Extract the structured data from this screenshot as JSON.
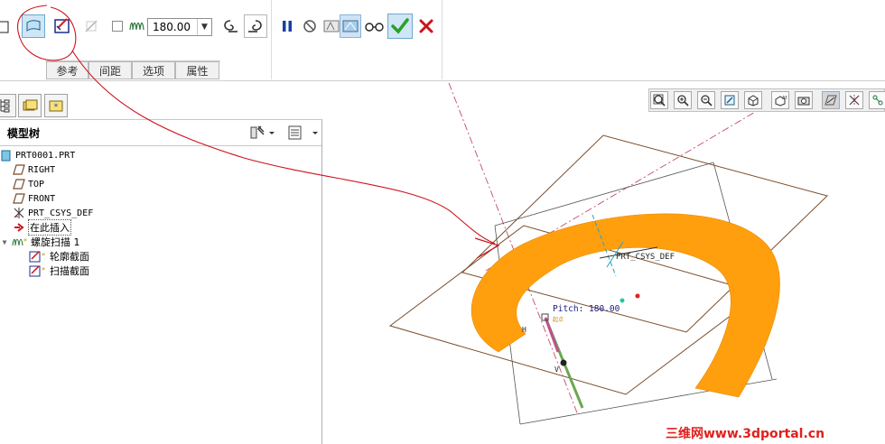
{
  "dashboard": {
    "pitch_value": "180.00",
    "tabs": [
      "参考",
      "间距",
      "选项",
      "属性"
    ]
  },
  "navigator": {
    "title": "模型树",
    "tree": [
      {
        "label": "PRT0001.PRT"
      },
      {
        "label": "RIGHT"
      },
      {
        "label": "TOP"
      },
      {
        "label": "FRONT"
      },
      {
        "label": "PRT_CSYS_DEF"
      },
      {
        "label": "在此插入"
      },
      {
        "label": "螺旋扫描 1"
      },
      {
        "label": "轮廓截面"
      },
      {
        "label": "扫描截面"
      }
    ]
  },
  "graphics": {
    "csys_label": "PRT_CSYS_DEF",
    "pitch_label": "Pitch: 180.00",
    "axis_h": "H",
    "axis_v": "V",
    "start_label": "起点"
  },
  "watermark": {
    "cn": "三维网",
    "url": "www.3dportal.cn"
  },
  "colors": {
    "sweep": "#ff9f0e",
    "datum_plane": "#7a4b2a",
    "annotation_red": "#d0101a",
    "confirm_green": "#2aa02a",
    "cancel_red": "#c8141e"
  }
}
